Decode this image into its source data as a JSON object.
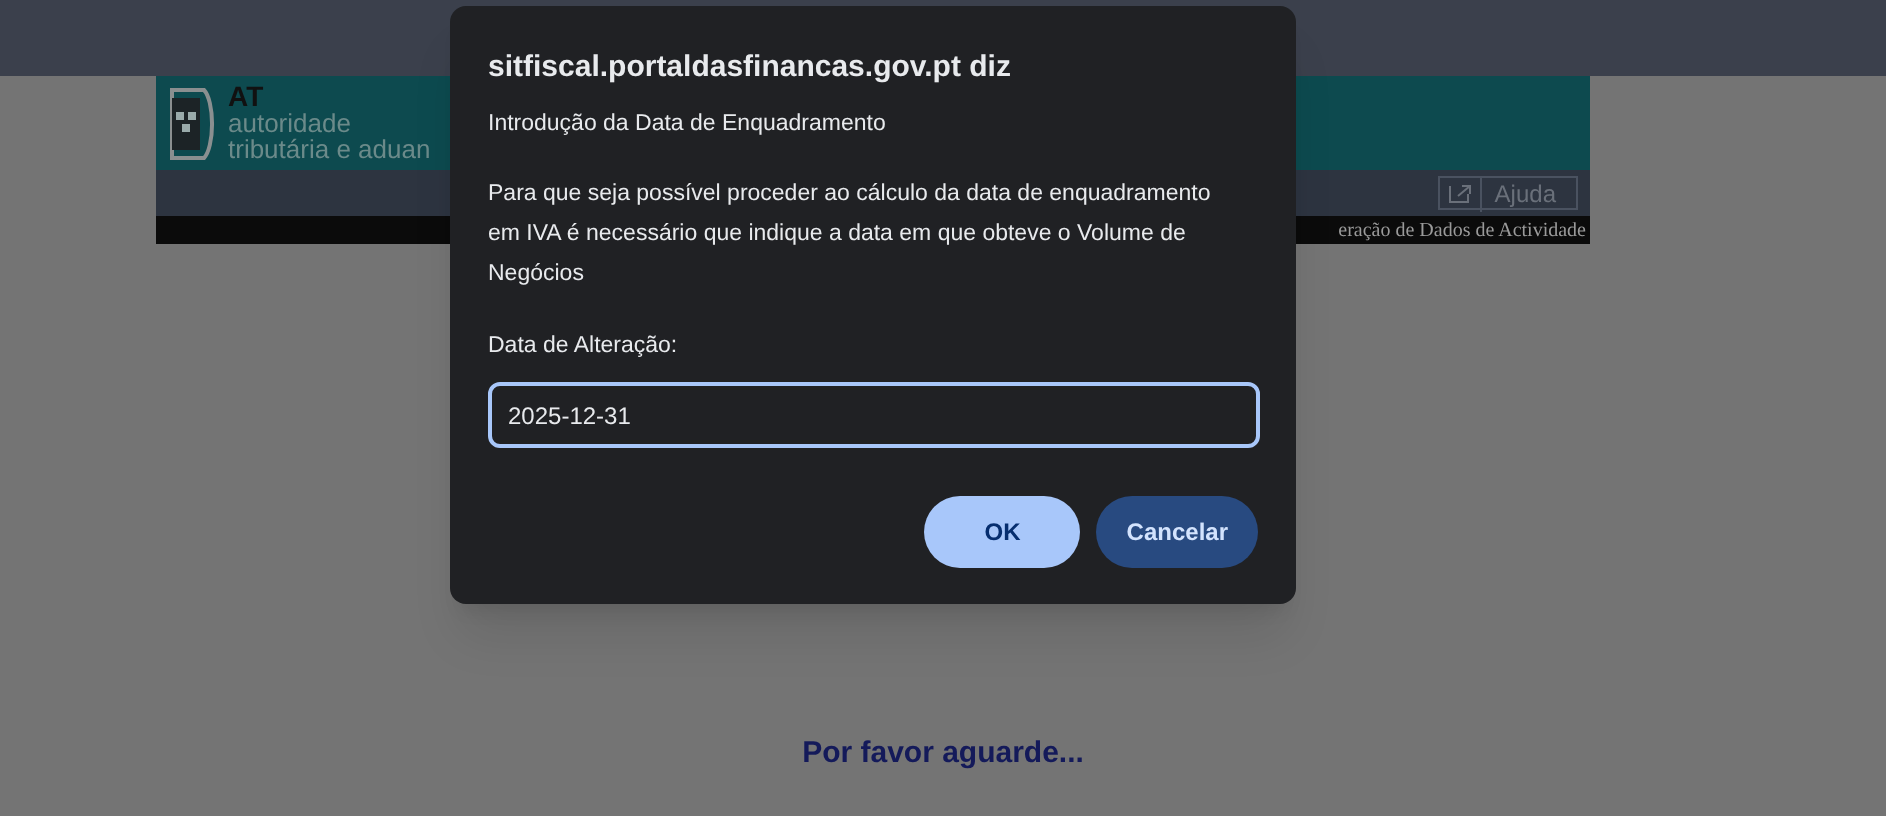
{
  "header": {
    "logo_short": "AT",
    "logo_line_1": "autoridade",
    "logo_line_2": "tributária e aduan",
    "help_button": "Ajuda",
    "breadcrumb": "eração de Dados de Actividade"
  },
  "dialog": {
    "title": "sitfiscal.portaldasfinancas.gov.pt diz",
    "subtitle": "Introdução da Data de Enquadramento",
    "message": "Para que seja possível proceder ao cálculo da data de enquadramento em IVA é necessário que indique a data em que obteve o Volume de Negócios",
    "field_label": "Data de Alteração:",
    "field_value": "2025-12-31",
    "buttons": [
      {
        "label": "OK",
        "kind": "primary"
      },
      {
        "label": "Cancelar",
        "kind": "secondary"
      }
    ]
  },
  "waiting_text": "Por favor aguarde..."
}
